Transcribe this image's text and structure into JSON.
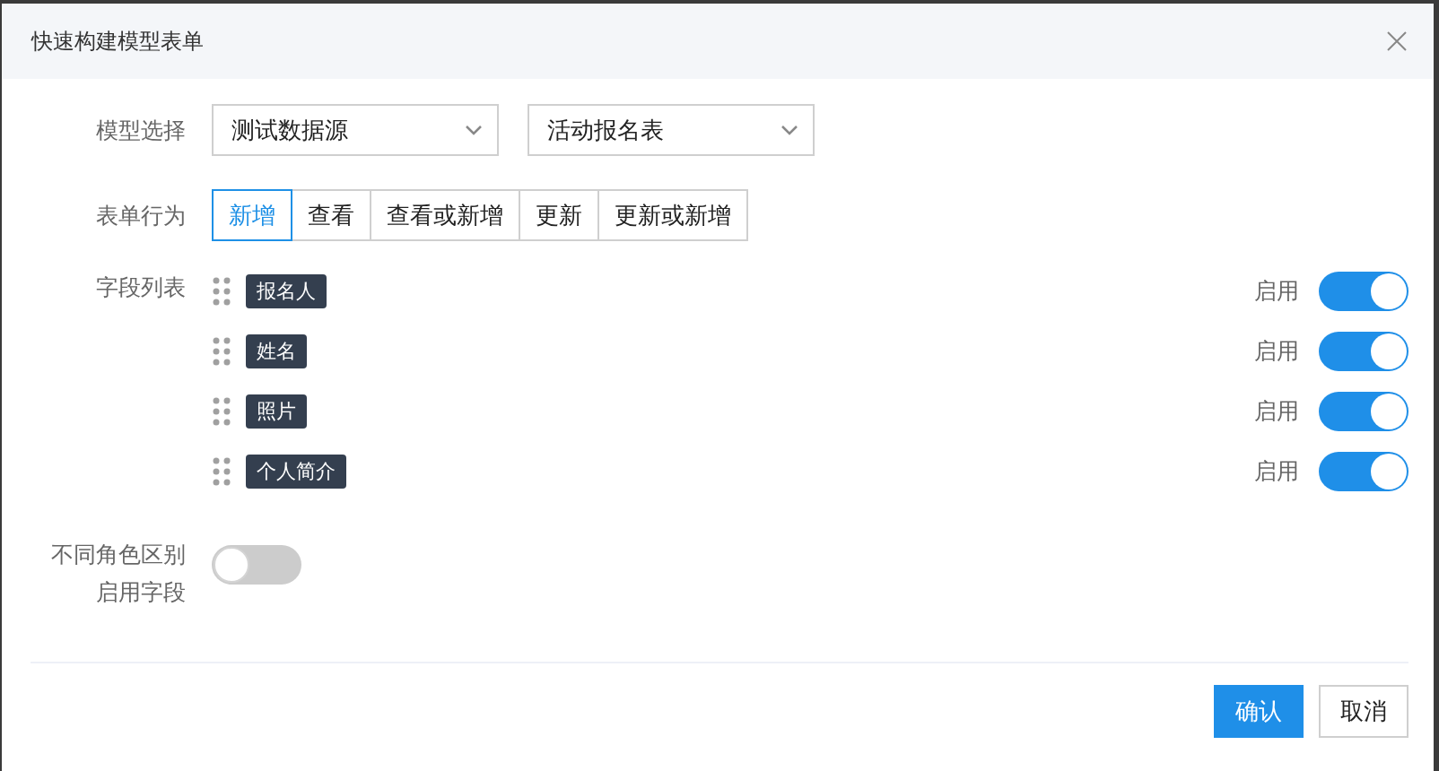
{
  "dialog": {
    "title": "快速构建模型表单"
  },
  "model_select": {
    "label": "模型选择",
    "selects": [
      {
        "value": "测试数据源"
      },
      {
        "value": "活动报名表"
      }
    ]
  },
  "form_behavior": {
    "label": "表单行为",
    "options": [
      {
        "label": "新增",
        "selected": true
      },
      {
        "label": "查看",
        "selected": false
      },
      {
        "label": "查看或新增",
        "selected": false
      },
      {
        "label": "更新",
        "selected": false
      },
      {
        "label": "更新或新增",
        "selected": false
      }
    ]
  },
  "field_list": {
    "label": "字段列表",
    "fields": [
      {
        "name": "报名人",
        "toggle_label": "启用",
        "on": true
      },
      {
        "name": "姓名",
        "toggle_label": "启用",
        "on": true
      },
      {
        "name": "照片",
        "toggle_label": "启用",
        "on": true
      },
      {
        "name": "个人简介",
        "toggle_label": "启用",
        "on": true
      }
    ]
  },
  "role_fields": {
    "label_lines": [
      "不同角色区别",
      "启用字段"
    ],
    "on": false
  },
  "buttons": [
    {
      "label": "确认",
      "kind": "primary"
    },
    {
      "label": "取消",
      "kind": "secondary"
    }
  ]
}
